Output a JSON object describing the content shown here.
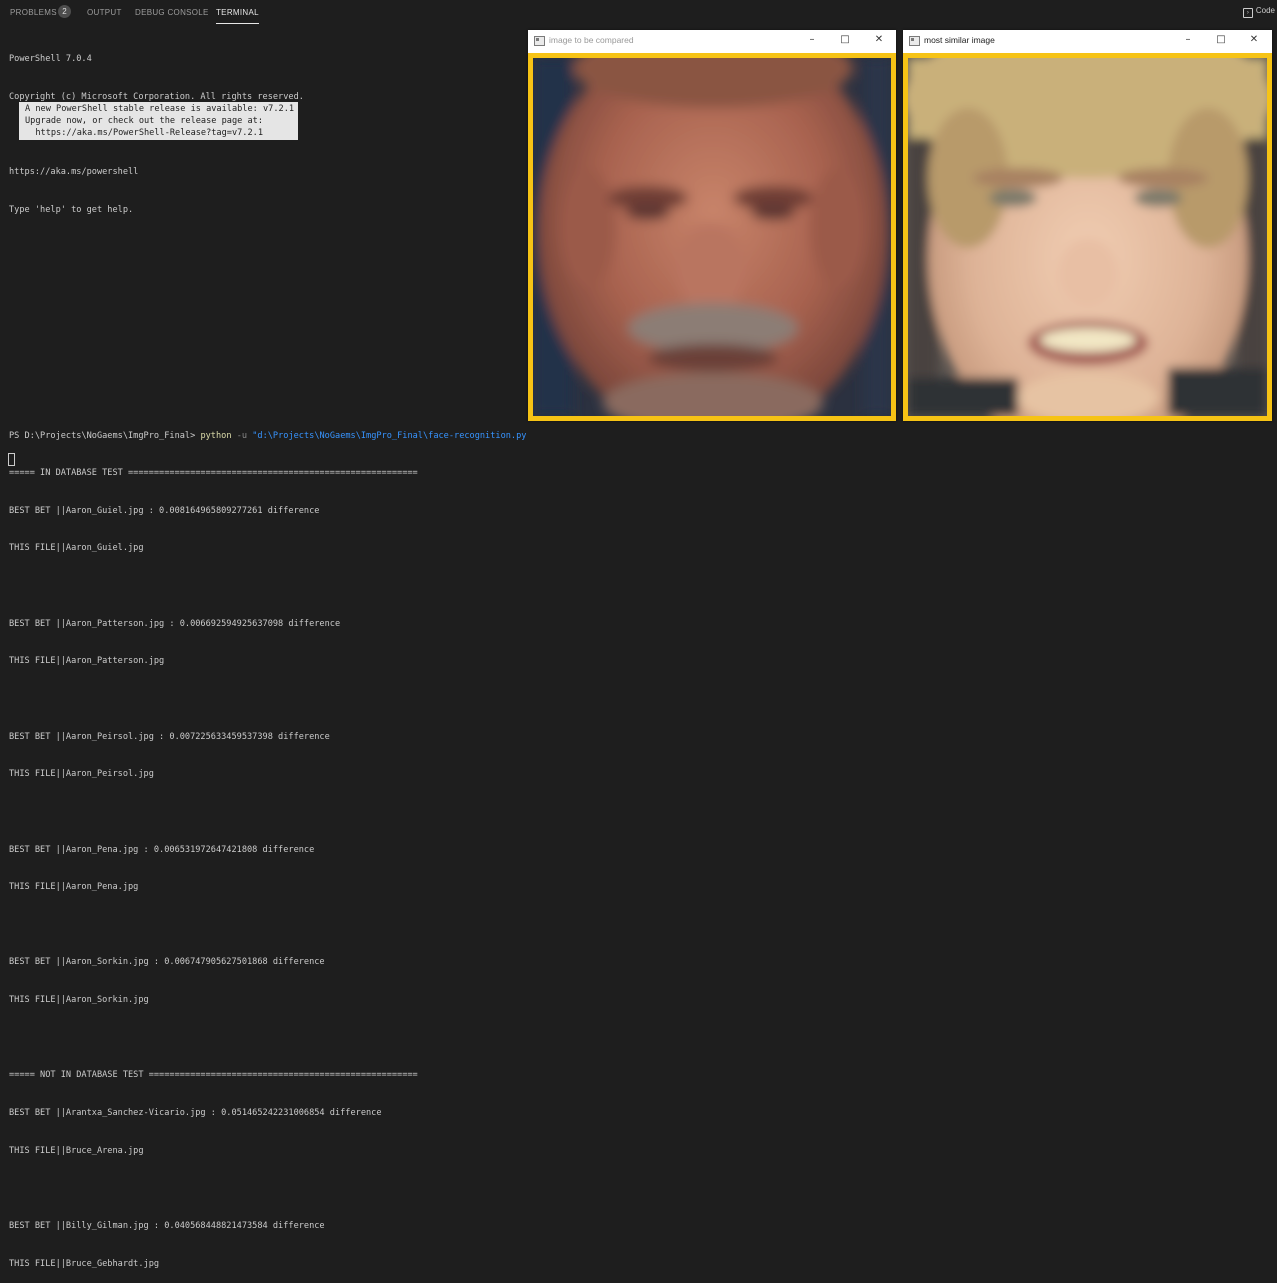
{
  "panel": {
    "tabs": [
      {
        "label": "PROBLEMS",
        "badge": "2"
      },
      {
        "label": "OUTPUT"
      },
      {
        "label": "DEBUG CONSOLE"
      },
      {
        "label": "TERMINAL"
      }
    ],
    "right_button": "Code"
  },
  "terminal": {
    "intro": [
      "PowerShell 7.0.4",
      "Copyright (c) Microsoft Corporation. All rights reserved.",
      "",
      "https://aka.ms/powershell",
      "Type 'help' to get help."
    ],
    "notice": [
      "A new PowerShell stable release is available: v7.2.1",
      "Upgrade now, or check out the release page at:",
      "  https://aka.ms/PowerShell-Release?tag=v7.2.1"
    ],
    "prompt": "PS D:\\Projects\\NoGaems\\ImgPro_Final>",
    "command": "python",
    "flag": "-u",
    "script_path": "\"d:\\Projects\\NoGaems\\ImgPro_Final\\face-recognition.py",
    "output": [
      "===== IN DATABASE TEST ========================================================",
      "BEST BET ||Aaron_Guiel.jpg : 0.008164965809277261 difference",
      "THIS FILE||Aaron_Guiel.jpg",
      "",
      "BEST BET ||Aaron_Patterson.jpg : 0.006692594925637098 difference",
      "THIS FILE||Aaron_Patterson.jpg",
      "",
      "BEST BET ||Aaron_Peirsol.jpg : 0.007225633459537398 difference",
      "THIS FILE||Aaron_Peirsol.jpg",
      "",
      "BEST BET ||Aaron_Pena.jpg : 0.006531972647421808 difference",
      "THIS FILE||Aaron_Pena.jpg",
      "",
      "BEST BET ||Aaron_Sorkin.jpg : 0.006747905627501868 difference",
      "THIS FILE||Aaron_Sorkin.jpg",
      "",
      "===== NOT IN DATABASE TEST ====================================================",
      "BEST BET ||Arantxa_Sanchez-Vicario.jpg : 0.05146524223100685​4 difference",
      "THIS FILE||Bruce_Arena.jpg",
      "",
      "BEST BET ||Billy_Gilman.jpg : 0.040568448821473584 difference",
      "THIS FILE||Bruce_Gebhardt.jpg"
    ]
  },
  "windows": [
    {
      "title": "image to be compared"
    },
    {
      "title": "most similar image"
    }
  ],
  "colors": {
    "terminal_bg": "#1e1e1e",
    "frame_yellow": "#f6c315",
    "prompt_text": "#cccccc",
    "command": "#dcdcaa",
    "path": "#3794ff"
  }
}
